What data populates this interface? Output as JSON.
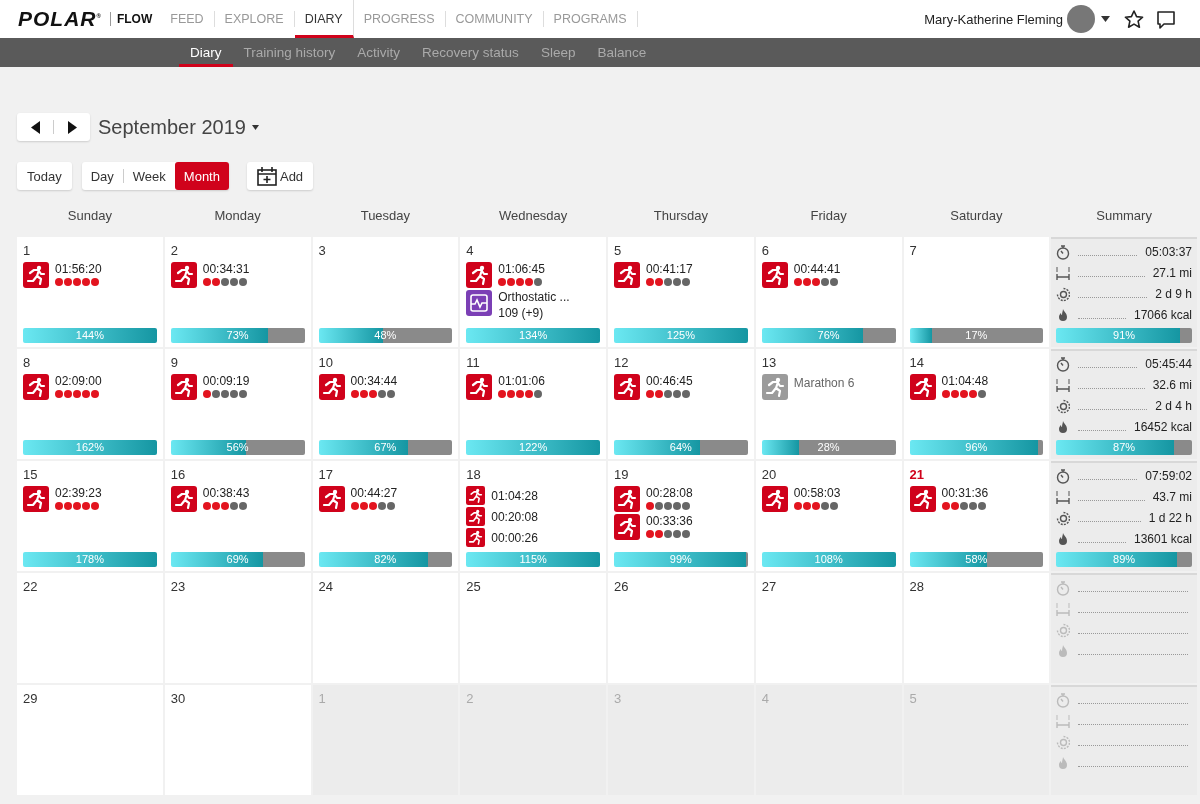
{
  "brand": {
    "logo": "POLAR",
    "mark": "®",
    "product": "FLOW"
  },
  "nav": [
    {
      "label": "FEED",
      "selected": false
    },
    {
      "label": "EXPLORE",
      "selected": false
    },
    {
      "label": "DIARY",
      "selected": true
    },
    {
      "label": "PROGRESS",
      "selected": false
    },
    {
      "label": "COMMUNITY",
      "selected": false
    },
    {
      "label": "PROGRAMS",
      "selected": false
    }
  ],
  "user": {
    "name": "Mary-Katherine Fleming"
  },
  "subnav": [
    {
      "label": "Diary",
      "selected": true
    },
    {
      "label": "Training history",
      "selected": false
    },
    {
      "label": "Activity",
      "selected": false
    },
    {
      "label": "Recovery status",
      "selected": false
    },
    {
      "label": "Sleep",
      "selected": false
    },
    {
      "label": "Balance",
      "selected": false
    }
  ],
  "calendar": {
    "month": "September 2019",
    "today_button": "Today",
    "add_button": "Add",
    "views": [
      {
        "label": "Day",
        "selected": false
      },
      {
        "label": "Week",
        "selected": false
      },
      {
        "label": "Month",
        "selected": true
      }
    ],
    "weekdays": [
      "Sunday",
      "Monday",
      "Tuesday",
      "Wednesday",
      "Thursday",
      "Friday",
      "Saturday",
      "Summary"
    ],
    "weeks": [
      {
        "days": [
          {
            "day": "1",
            "outside": false,
            "today": false,
            "workouts": [
              {
                "kind": "run",
                "time": "01:56:20",
                "stars": 5
              }
            ],
            "progress": {
              "label": "144%",
              "level": 1
            }
          },
          {
            "day": "2",
            "outside": false,
            "today": false,
            "workouts": [
              {
                "kind": "run",
                "time": "00:34:31",
                "stars": 2
              }
            ],
            "progress": {
              "label": "73%",
              "level": 0.73
            }
          },
          {
            "day": "3",
            "outside": false,
            "today": false,
            "progress": {
              "label": "48%",
              "level": 0.48
            }
          },
          {
            "day": "4",
            "outside": false,
            "today": false,
            "workouts": [
              {
                "kind": "run",
                "time": "01:06:45",
                "stars": 4
              },
              {
                "kind": "test",
                "time": "Orthostatic ...",
                "detail": "109 (+9)"
              }
            ],
            "progress": {
              "label": "134%",
              "level": 1
            }
          },
          {
            "day": "5",
            "outside": false,
            "today": false,
            "workouts": [
              {
                "kind": "run",
                "time": "00:41:17",
                "stars": 2
              }
            ],
            "progress": {
              "label": "125%",
              "level": 1
            }
          },
          {
            "day": "6",
            "outside": false,
            "today": false,
            "workouts": [
              {
                "kind": "run",
                "time": "00:44:41",
                "stars": 3
              }
            ],
            "progress": {
              "label": "76%",
              "level": 0.76
            }
          },
          {
            "day": "7",
            "outside": false,
            "today": false,
            "progress": {
              "label": "17%",
              "level": 0.17
            }
          }
        ],
        "summary": {
          "stats": [
            {
              "kind": "duration",
              "value": "05:03:37"
            },
            {
              "kind": "distance",
              "value": "27.1 mi"
            },
            {
              "kind": "recovery",
              "value": "2 d 9 h"
            },
            {
              "kind": "calories",
              "value": "17066 kcal"
            }
          ],
          "progress": {
            "label": "91%",
            "level": 0.91
          }
        }
      },
      {
        "days": [
          {
            "day": "8",
            "outside": false,
            "today": false,
            "workouts": [
              {
                "kind": "run",
                "time": "02:09:00",
                "stars": 5
              }
            ],
            "progress": {
              "label": "162%",
              "level": 1
            }
          },
          {
            "day": "9",
            "outside": false,
            "today": false,
            "workouts": [
              {
                "kind": "run",
                "time": "00:09:19",
                "stars": 1
              }
            ],
            "progress": {
              "label": "56%",
              "level": 0.56
            }
          },
          {
            "day": "10",
            "outside": false,
            "today": false,
            "workouts": [
              {
                "kind": "run",
                "time": "00:34:44",
                "stars": 3
              }
            ],
            "progress": {
              "label": "67%",
              "level": 0.67
            }
          },
          {
            "day": "11",
            "outside": false,
            "today": false,
            "workouts": [
              {
                "kind": "run",
                "time": "01:01:06",
                "stars": 4
              }
            ],
            "progress": {
              "label": "122%",
              "level": 1
            }
          },
          {
            "day": "12",
            "outside": false,
            "today": false,
            "workouts": [
              {
                "kind": "run",
                "time": "00:46:45",
                "stars": 2
              }
            ],
            "progress": {
              "label": "64%",
              "level": 0.64
            }
          },
          {
            "day": "13",
            "outside": false,
            "today": false,
            "workouts": [
              {
                "kind": "planned",
                "time": "Marathon 6"
              }
            ],
            "progress": {
              "label": "28%",
              "level": 0.28
            }
          },
          {
            "day": "14",
            "outside": false,
            "today": false,
            "workouts": [
              {
                "kind": "run",
                "time": "01:04:48",
                "stars": 4
              }
            ],
            "progress": {
              "label": "96%",
              "level": 0.96
            }
          }
        ],
        "summary": {
          "stats": [
            {
              "kind": "duration",
              "value": "05:45:44"
            },
            {
              "kind": "distance",
              "value": "32.6 mi"
            },
            {
              "kind": "recovery",
              "value": "2 d 4 h"
            },
            {
              "kind": "calories",
              "value": "16452 kcal"
            }
          ],
          "progress": {
            "label": "87%",
            "level": 0.87
          }
        }
      },
      {
        "days": [
          {
            "day": "15",
            "outside": false,
            "today": false,
            "workouts": [
              {
                "kind": "run",
                "time": "02:39:23",
                "stars": 5
              }
            ],
            "progress": {
              "label": "178%",
              "level": 1
            }
          },
          {
            "day": "16",
            "outside": false,
            "today": false,
            "workouts": [
              {
                "kind": "run",
                "time": "00:38:43",
                "stars": 3
              }
            ],
            "progress": {
              "label": "69%",
              "level": 0.69
            }
          },
          {
            "day": "17",
            "outside": false,
            "today": false,
            "workouts": [
              {
                "kind": "run",
                "time": "00:44:27",
                "stars": 3
              }
            ],
            "progress": {
              "label": "82%",
              "level": 0.82
            }
          },
          {
            "day": "18",
            "outside": false,
            "today": false,
            "workouts": [
              {
                "kind": "small",
                "time": "01:04:28"
              },
              {
                "kind": "small",
                "time": "00:20:08"
              },
              {
                "kind": "small",
                "time": "00:00:26"
              }
            ],
            "progress": {
              "label": "115%",
              "level": 1
            }
          },
          {
            "day": "19",
            "outside": false,
            "today": false,
            "workouts": [
              {
                "kind": "run",
                "time": "00:28:08",
                "stars": 1
              },
              {
                "kind": "run",
                "time": "00:33:36",
                "stars": 2
              }
            ],
            "progress": {
              "label": "99%",
              "level": 0.99
            }
          },
          {
            "day": "20",
            "outside": false,
            "today": false,
            "workouts": [
              {
                "kind": "run",
                "time": "00:58:03",
                "stars": 3
              }
            ],
            "progress": {
              "label": "108%",
              "level": 1
            }
          },
          {
            "day": "21",
            "outside": false,
            "today": true,
            "workouts": [
              {
                "kind": "run",
                "time": "00:31:36",
                "stars": 2
              }
            ],
            "progress": {
              "label": "58%",
              "level": 0.58
            }
          }
        ],
        "summary": {
          "stats": [
            {
              "kind": "duration",
              "value": "07:59:02"
            },
            {
              "kind": "distance",
              "value": "43.7 mi"
            },
            {
              "kind": "recovery",
              "value": "1 d 22 h"
            },
            {
              "kind": "calories",
              "value": "13601 kcal"
            }
          ],
          "progress": {
            "label": "89%",
            "level": 0.89
          }
        }
      },
      {
        "days": [
          {
            "day": "22",
            "outside": false,
            "today": false
          },
          {
            "day": "23",
            "outside": false,
            "today": false
          },
          {
            "day": "24",
            "outside": false,
            "today": false
          },
          {
            "day": "25",
            "outside": false,
            "today": false
          },
          {
            "day": "26",
            "outside": false,
            "today": false
          },
          {
            "day": "27",
            "outside": false,
            "today": false
          },
          {
            "day": "28",
            "outside": false,
            "today": false
          }
        ],
        "summary": {
          "stats": [
            {
              "kind": "duration"
            },
            {
              "kind": "distance"
            },
            {
              "kind": "recovery"
            },
            {
              "kind": "calories"
            }
          ]
        }
      },
      {
        "days": [
          {
            "day": "29",
            "outside": false,
            "today": false
          },
          {
            "day": "30",
            "outside": false,
            "today": false
          },
          {
            "day": "1",
            "outside": true,
            "today": false
          },
          {
            "day": "2",
            "outside": true,
            "today": false
          },
          {
            "day": "3",
            "outside": true,
            "today": false
          },
          {
            "day": "4",
            "outside": true,
            "today": false
          },
          {
            "day": "5",
            "outside": true,
            "today": false
          }
        ],
        "summary": {
          "stats": [
            {
              "kind": "duration"
            },
            {
              "kind": "distance"
            },
            {
              "kind": "recovery"
            },
            {
              "kind": "calories"
            }
          ]
        }
      }
    ]
  }
}
